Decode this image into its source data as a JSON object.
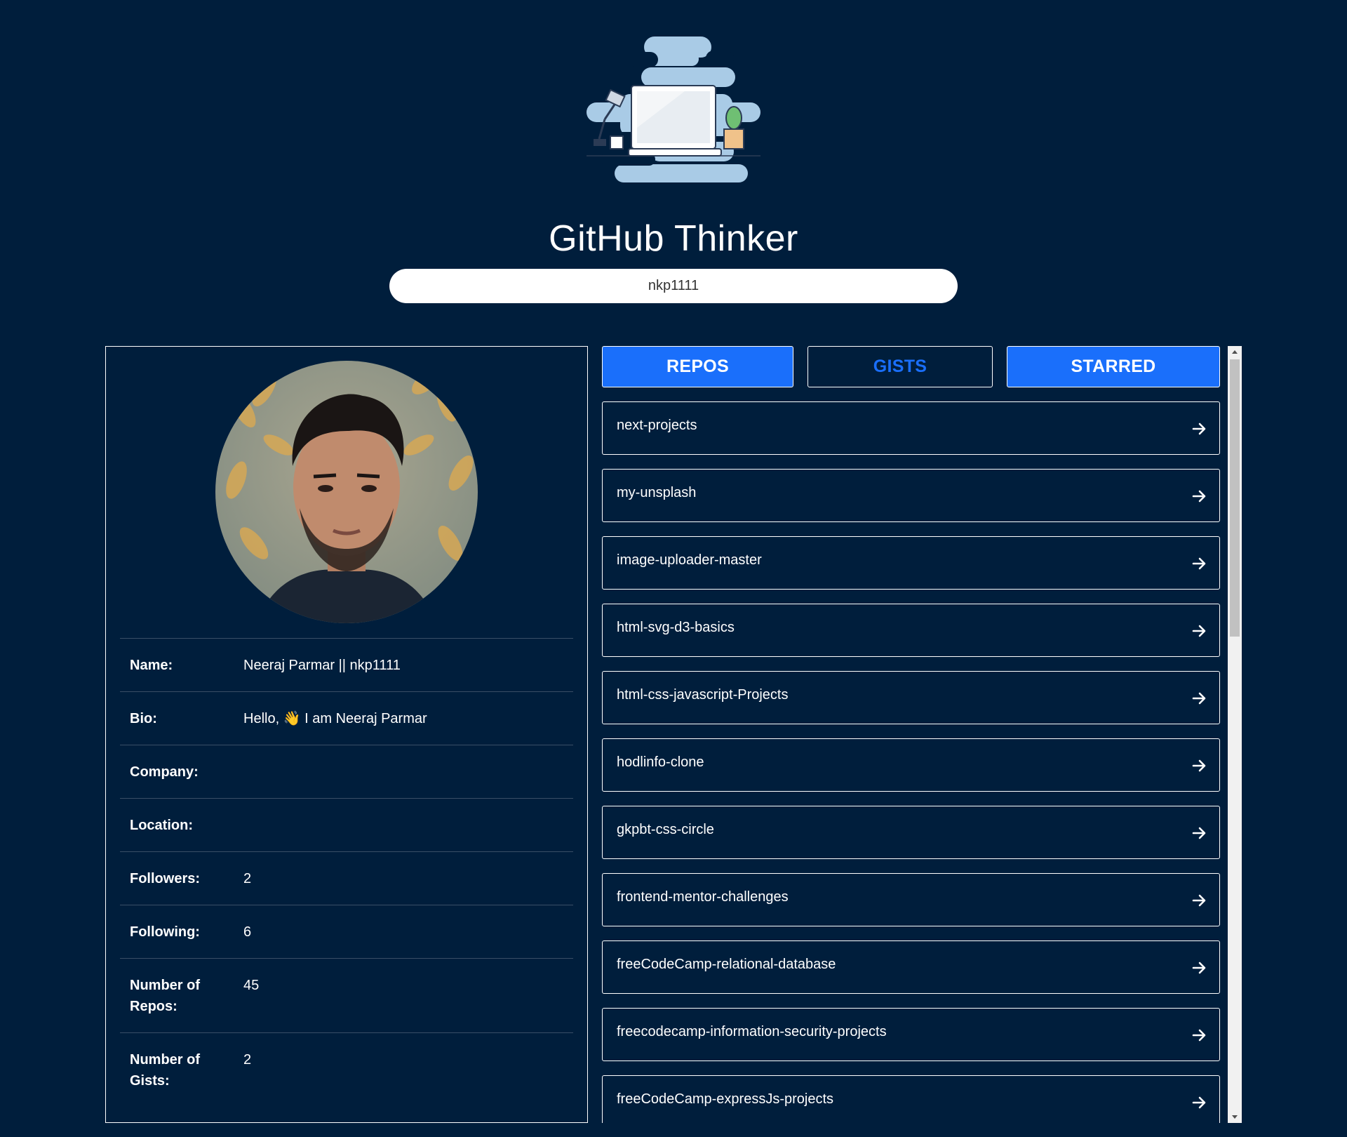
{
  "app": {
    "title": "GitHub Thinker"
  },
  "search": {
    "value": "nkp1111",
    "placeholder": ""
  },
  "profile": {
    "avatar_alt": "avatar",
    "fields": [
      {
        "label": "Name:",
        "value": "Neeraj Parmar || nkp1111"
      },
      {
        "label": "Bio:",
        "value": "Hello,  👋 I am Neeraj Parmar"
      },
      {
        "label": "Company:",
        "value": ""
      },
      {
        "label": "Location:",
        "value": ""
      },
      {
        "label": "Followers:",
        "value": "2"
      },
      {
        "label": "Following:",
        "value": "6"
      },
      {
        "label": "Number of Repos:",
        "value": "45"
      },
      {
        "label": "Number of Gists:",
        "value": "2"
      }
    ]
  },
  "tabs": {
    "repos": "REPOS",
    "gists": "GISTS",
    "starred": "STARRED"
  },
  "repos": [
    {
      "name": "next-projects"
    },
    {
      "name": "my-unsplash"
    },
    {
      "name": "image-uploader-master"
    },
    {
      "name": "html-svg-d3-basics"
    },
    {
      "name": "html-css-javascript-Projects"
    },
    {
      "name": "hodlinfo-clone"
    },
    {
      "name": "gkpbt-css-circle"
    },
    {
      "name": "frontend-mentor-challenges"
    },
    {
      "name": "freeCodeCamp-relational-database"
    },
    {
      "name": "freecodecamp-information-security-projects"
    },
    {
      "name": "freeCodeCamp-expressJs-projects"
    }
  ],
  "icons": {
    "repo_arrow": "arrow-right-icon",
    "logo": "laptop-desk-illustration"
  },
  "colors": {
    "background": "#001e3c",
    "accent": "#1a6ffb",
    "text": "#ffffff"
  }
}
